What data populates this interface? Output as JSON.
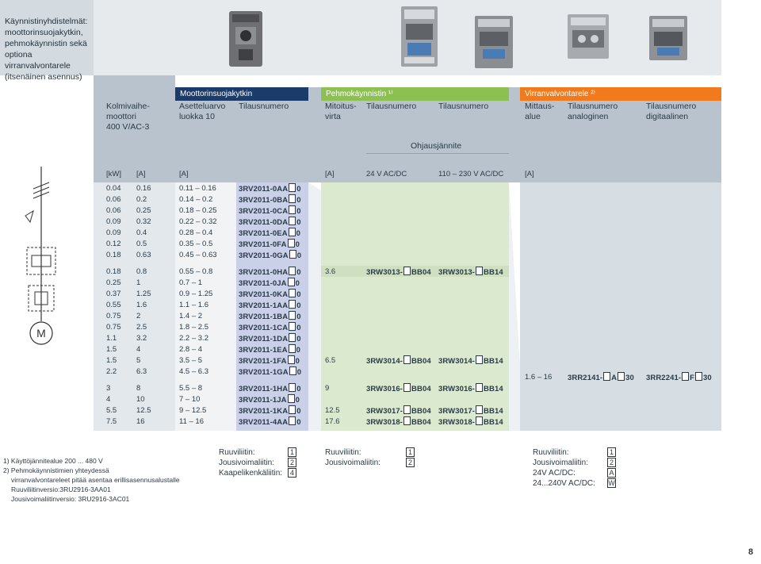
{
  "title": "Käynnistinyhdistelmät: moottorinsuojakytkin, pehmokäynnistin sekä optiona virranvalvontarele (itsenäinen asennus)",
  "title_lines": [
    "Käynnistinyhdistelmät:",
    "moottorinsuojakytkin,",
    "pehmokäynnistin sekä",
    "optiona virranvalvontarele",
    "(itsenäinen asennus)"
  ],
  "bands": {
    "mps": "Moottorinsuojakytkin",
    "soft": "Pehmokäynnistin ¹⁾",
    "relay": "Virranvalvontarele ²⁾"
  },
  "colors": {
    "mps": "#1b3c6a",
    "soft": "#8cc152",
    "relay": "#f07a1c",
    "grey": "#b8c3cd",
    "lightgrey": "#d6dde3",
    "green": "#dbe9cf",
    "blue": "#aab4d8"
  },
  "headers": {
    "motor": [
      "Kolmivaihe-",
      "moottori",
      "400 V/AC-3"
    ],
    "setting": [
      "Asetteluarvo",
      "luokka 10"
    ],
    "order": "Tilausnumero",
    "rated": [
      "Mitoitus-",
      "virta"
    ],
    "order_soft_a": "Tilausnumero",
    "order_soft_b": "Tilausnumero",
    "range": [
      "Mittaus-",
      "alue"
    ],
    "order_analog": [
      "Tilausnumero",
      "analoginen"
    ],
    "order_digital": [
      "Tilausnumero",
      "digitaalinen"
    ],
    "control_voltage": "Ohjausjännite"
  },
  "units": {
    "kw": "[kW]",
    "a1": "[A]",
    "a2": "[A]",
    "a3": "[A]",
    "v24": "24 V AC/DC",
    "v110": "110 – 230 V AC/DC",
    "a4": "[A]"
  },
  "rows": [
    {
      "kw": "0.04",
      "a": "0.16",
      "set": "0.11 – 0.16",
      "code": "3RV2011-0AA",
      "end": "0"
    },
    {
      "kw": "0.06",
      "a": "0.2",
      "set": "0.14 – 0.2",
      "code": "3RV2011-0BA",
      "end": "0"
    },
    {
      "kw": "0.06",
      "a": "0.25",
      "set": "0.18 – 0.25",
      "code": "3RV2011-0CA",
      "end": "0"
    },
    {
      "kw": "0.09",
      "a": "0.32",
      "set": "0.22 – 0.32",
      "code": "3RV2011-0DA",
      "end": "0"
    },
    {
      "kw": "0.09",
      "a": "0.4",
      "set": "0.28 – 0.4",
      "code": "3RV2011-0EA",
      "end": "0"
    },
    {
      "kw": "0.12",
      "a": "0.5",
      "set": "0.35 – 0.5",
      "code": "3RV2011-0FA",
      "end": "0"
    },
    {
      "kw": "0.18",
      "a": "0.63",
      "set": "0.45 – 0.63",
      "code": "3RV2011-0GA",
      "end": "0"
    },
    {
      "kw": "0.18",
      "a": "0.8",
      "set": "0.55 – 0.8",
      "code": "3RV2011-0HA",
      "end": "0"
    },
    {
      "kw": "0.25",
      "a": "1",
      "set": "0.7 – 1",
      "code": "3RV2011-0JA",
      "end": "0"
    },
    {
      "kw": "0.37",
      "a": "1.25",
      "set": "0.9 – 1.25",
      "code": "3RV2011-0KA",
      "end": "0"
    },
    {
      "kw": "0.55",
      "a": "1.6",
      "set": "1.1 – 1.6",
      "code": "3RV2011-1AA",
      "end": "0"
    },
    {
      "kw": "0.75",
      "a": "2",
      "set": "1.4 – 2",
      "code": "3RV2011-1BA",
      "end": "0"
    },
    {
      "kw": "0.75",
      "a": "2.5",
      "set": "1.8 – 2.5",
      "code": "3RV2011-1CA",
      "end": "0"
    },
    {
      "kw": "1.1",
      "a": "3.2",
      "set": "2.2 – 3.2",
      "code": "3RV2011-1DA",
      "end": "0"
    },
    {
      "kw": "1.5",
      "a": "4",
      "set": "2.8 – 4",
      "code": "3RV2011-1EA",
      "end": "0"
    },
    {
      "kw": "1.5",
      "a": "5",
      "set": "3.5 – 5",
      "code": "3RV2011-1FA",
      "end": "0"
    },
    {
      "kw": "2.2",
      "a": "6.3",
      "set": "4.5 – 6.3",
      "code": "3RV2011-1GA",
      "end": "0"
    },
    {
      "kw": "3",
      "a": "8",
      "set": "5.5 – 8",
      "code": "3RV2011-1HA",
      "end": "0"
    },
    {
      "kw": "4",
      "a": "10",
      "set": "7 – 10",
      "code": "3RV2011-1JA",
      "end": "0"
    },
    {
      "kw": "5.5",
      "a": "12.5",
      "set": "9 – 12.5",
      "code": "3RV2011-1KA",
      "end": "0"
    },
    {
      "kw": "7.5",
      "a": "16",
      "set": "11 – 16",
      "code": "3RV2011-4AA",
      "end": "0"
    }
  ],
  "soft_rows": [
    {
      "rated": "3.6",
      "a_pre": "3RW3013-",
      "a_post": "BB04",
      "b_pre": "3RW3013-",
      "b_post": "BB14"
    },
    {
      "rated": "6.5",
      "a_pre": "3RW3014-",
      "a_post": "BB04",
      "b_pre": "3RW3014-",
      "b_post": "BB14"
    },
    {
      "rated": "9",
      "a_pre": "3RW3016-",
      "a_post": "BB04",
      "b_pre": "3RW3016-",
      "b_post": "BB14"
    },
    {
      "rated": "12.5",
      "a_pre": "3RW3017-",
      "a_post": "BB04",
      "b_pre": "3RW3017-",
      "b_post": "BB14"
    },
    {
      "rated": "17.6",
      "a_pre": "3RW3018-",
      "a_post": "BB04",
      "b_pre": "3RW3018-",
      "b_post": "BB14"
    }
  ],
  "relay_row": {
    "range": "1.6 – 16",
    "analog_pre": "3RR2141-",
    "analog_mid": "A",
    "analog_post": "30",
    "digital_pre": "3RR2241-",
    "digital_mid": "F",
    "digital_post": "30"
  },
  "footnotes": [
    "1) Käyttöjännitealue 200 ... 480 V",
    "2) Pehmokäynnistimien yhteydessä",
    "virranvalvontareleet pitää asentaa erillisasennusalustalle",
    "Ruuviliitinversio:3RU2916-3AA01",
    "Jousivoimaliitinversio: 3RU2916-3AC01"
  ],
  "legend_mps": [
    {
      "label": "Ruuviliitin:",
      "code": "1"
    },
    {
      "label": "Jousivoimaliitin:",
      "code": "2"
    },
    {
      "label": "Kaapelikenkäliitin:",
      "code": "4"
    }
  ],
  "legend_soft": [
    {
      "label": "Ruuviliitin:",
      "code": "1"
    },
    {
      "label": "Jousivoimaliitin:",
      "code": "2"
    }
  ],
  "legend_relay": [
    {
      "label": "Ruuviliitin:",
      "code": "1"
    },
    {
      "label": "Jousivoimaliitin:",
      "code": "2"
    },
    {
      "label": "24V AC/DC:",
      "code": "A"
    },
    {
      "label": "24...240V AC/DC:",
      "code": "W"
    }
  ],
  "diagram_motor_label": "M",
  "page_number": "8"
}
